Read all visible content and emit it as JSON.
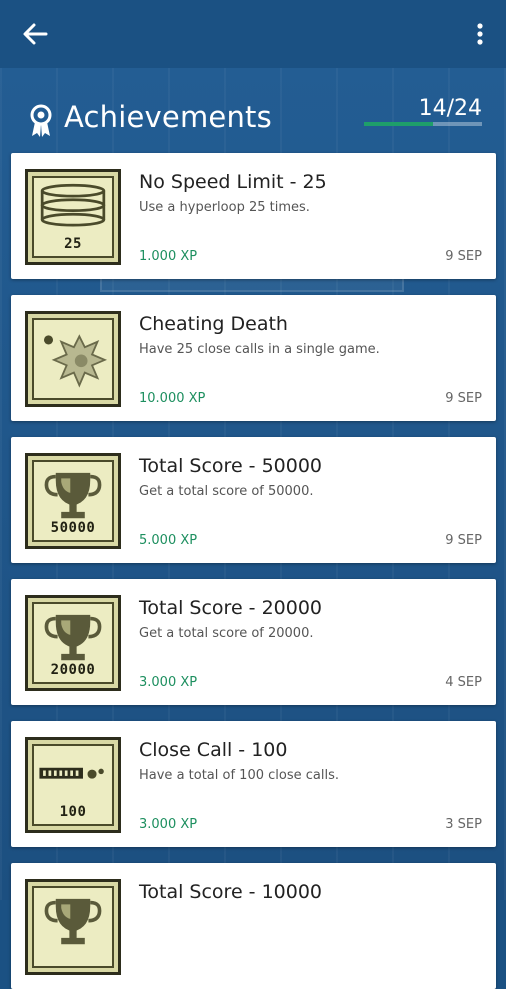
{
  "appbar": {
    "back_icon": "arrow-left-icon",
    "menu_icon": "more-vert-icon"
  },
  "header": {
    "icon": "award-ribbon-icon",
    "title": "Achievements",
    "count": "14/24",
    "progress": 0.583
  },
  "colors": {
    "appbar": "#1b5183",
    "xp": "#1d8f5f",
    "progress": "#1e9e6a",
    "badge_bg": "#d8d8a4"
  },
  "achievements": [
    {
      "title": "No Speed Limit - 25",
      "description": "Use a hyperloop 25 times.",
      "xp": "1.000 XP",
      "date": "9 SEP",
      "badge_icon": "hyperloop-rings-icon",
      "badge_label": "25"
    },
    {
      "title": "Cheating Death",
      "description": "Have 25 close calls in a single game.",
      "xp": "10.000 XP",
      "date": "9 SEP",
      "badge_icon": "explosion-icon",
      "badge_label": ""
    },
    {
      "title": "Total Score - 50000",
      "description": "Get a total score of 50000.",
      "xp": "5.000 XP",
      "date": "9 SEP",
      "badge_icon": "trophy-icon",
      "badge_label": "50000"
    },
    {
      "title": "Total Score - 20000",
      "description": "Get a total score of 20000.",
      "xp": "3.000 XP",
      "date": "4 SEP",
      "badge_icon": "trophy-icon",
      "badge_label": "20000"
    },
    {
      "title": "Close Call - 100",
      "description": "Have a total of 100 close calls.",
      "xp": "3.000 XP",
      "date": "3 SEP",
      "badge_icon": "close-call-icon",
      "badge_label": "100"
    },
    {
      "title": "Total Score - 10000",
      "description": "",
      "xp": "",
      "date": "",
      "badge_icon": "trophy-icon",
      "badge_label": ""
    }
  ]
}
